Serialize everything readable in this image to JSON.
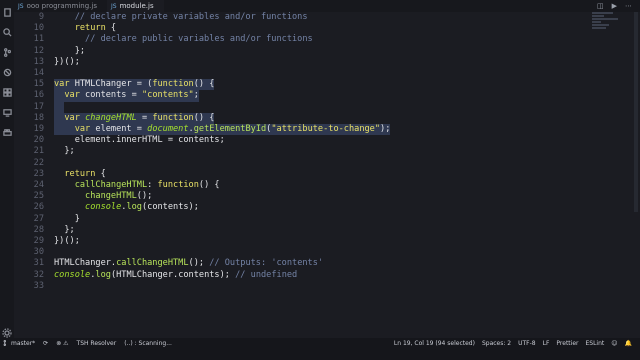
{
  "tabs": [
    {
      "label": "ooo programming.js",
      "active": false
    },
    {
      "label": "module.js",
      "active": true
    }
  ],
  "editor": {
    "lines": [
      {
        "num": "9",
        "tokens": [
          [
            "cm",
            "    // declare private variables and/or functions"
          ]
        ]
      },
      {
        "num": "10",
        "tokens": [
          [
            "kw",
            "    return"
          ],
          [
            "pl",
            " {"
          ]
        ]
      },
      {
        "num": "11",
        "tokens": [
          [
            "cm",
            "      // declare public variables and/or functions"
          ]
        ]
      },
      {
        "num": "12",
        "tokens": [
          [
            "pl",
            "    };"
          ]
        ]
      },
      {
        "num": "13",
        "tokens": [
          [
            "pl",
            "})();"
          ]
        ]
      },
      {
        "num": "14",
        "tokens": []
      },
      {
        "num": "15",
        "tokens": [
          [
            "kw",
            "var"
          ],
          [
            "pl",
            " HTMLChanger = ("
          ],
          [
            "kw",
            "function"
          ],
          [
            "pl",
            "() {"
          ]
        ]
      },
      {
        "num": "16",
        "tokens": [
          [
            "kw",
            "  var"
          ],
          [
            "pl",
            " contents = "
          ],
          [
            "str",
            "\"contents\""
          ],
          [
            "pl",
            ";"
          ]
        ]
      },
      {
        "num": "17",
        "tokens": []
      },
      {
        "num": "18",
        "tokens": [
          [
            "kw",
            "  var"
          ],
          [
            "pl",
            " "
          ],
          [
            "it",
            "changeHTML"
          ],
          [
            "pl",
            " = "
          ],
          [
            "kw",
            "function"
          ],
          [
            "pl",
            "() {"
          ]
        ]
      },
      {
        "num": "19",
        "tokens": [
          [
            "kw",
            "    var"
          ],
          [
            "pl",
            " element = "
          ],
          [
            "it",
            "document"
          ],
          [
            "pl",
            "."
          ],
          [
            "fn",
            "getElementById"
          ],
          [
            "pl",
            "("
          ],
          [
            "str",
            "\"attribute-to-change\""
          ],
          [
            "pl",
            ");"
          ]
        ]
      },
      {
        "num": "20",
        "tokens": [
          [
            "pl",
            "    element.innerHTML = contents;"
          ]
        ]
      },
      {
        "num": "21",
        "tokens": [
          [
            "pl",
            "  };"
          ]
        ]
      },
      {
        "num": "22",
        "tokens": []
      },
      {
        "num": "23",
        "tokens": [
          [
            "kw",
            "  return"
          ],
          [
            "pl",
            " {"
          ]
        ]
      },
      {
        "num": "24",
        "tokens": [
          [
            "fn",
            "    callChangeHTML"
          ],
          [
            "pl",
            ": "
          ],
          [
            "kw",
            "function"
          ],
          [
            "pl",
            "() {"
          ]
        ]
      },
      {
        "num": "25",
        "tokens": [
          [
            "fn",
            "      changeHTML"
          ],
          [
            "pl",
            "();"
          ]
        ]
      },
      {
        "num": "26",
        "tokens": [
          [
            "it",
            "      console"
          ],
          [
            "pl",
            "."
          ],
          [
            "fn",
            "log"
          ],
          [
            "pl",
            "(contents);"
          ]
        ]
      },
      {
        "num": "27",
        "tokens": [
          [
            "pl",
            "    }"
          ]
        ]
      },
      {
        "num": "28",
        "tokens": [
          [
            "pl",
            "  };"
          ]
        ]
      },
      {
        "num": "29",
        "tokens": [
          [
            "pl",
            "})();"
          ]
        ]
      },
      {
        "num": "30",
        "tokens": []
      },
      {
        "num": "31",
        "tokens": [
          [
            "pl",
            "HTMLChanger."
          ],
          [
            "fn",
            "callChangeHTML"
          ],
          [
            "pl",
            "(); "
          ],
          [
            "cm",
            "// Outputs: 'contents'"
          ]
        ]
      },
      {
        "num": "32",
        "tokens": [
          [
            "it",
            "console"
          ],
          [
            "pl",
            "."
          ],
          [
            "fn",
            "log"
          ],
          [
            "pl",
            "(HTMLChanger.contents); "
          ],
          [
            "cm",
            "// undefined"
          ]
        ]
      },
      {
        "num": "33",
        "tokens": []
      }
    ]
  },
  "status": {
    "branch": "master*",
    "resolver": "TSH Resolver",
    "scanning": "(..) : Scanning...",
    "position": "Ln 19, Col 19 (94 selected)",
    "spaces": "Spaces: 2",
    "encoding": "UTF-8",
    "eol": "LF",
    "formatter": "Prettier",
    "linter": "ESLint"
  },
  "colors": {
    "keyword": "#e8e066",
    "function": "#b7e35a",
    "comment": "#7483a6",
    "background": "#1b1c22",
    "selection": "#2d3447"
  }
}
